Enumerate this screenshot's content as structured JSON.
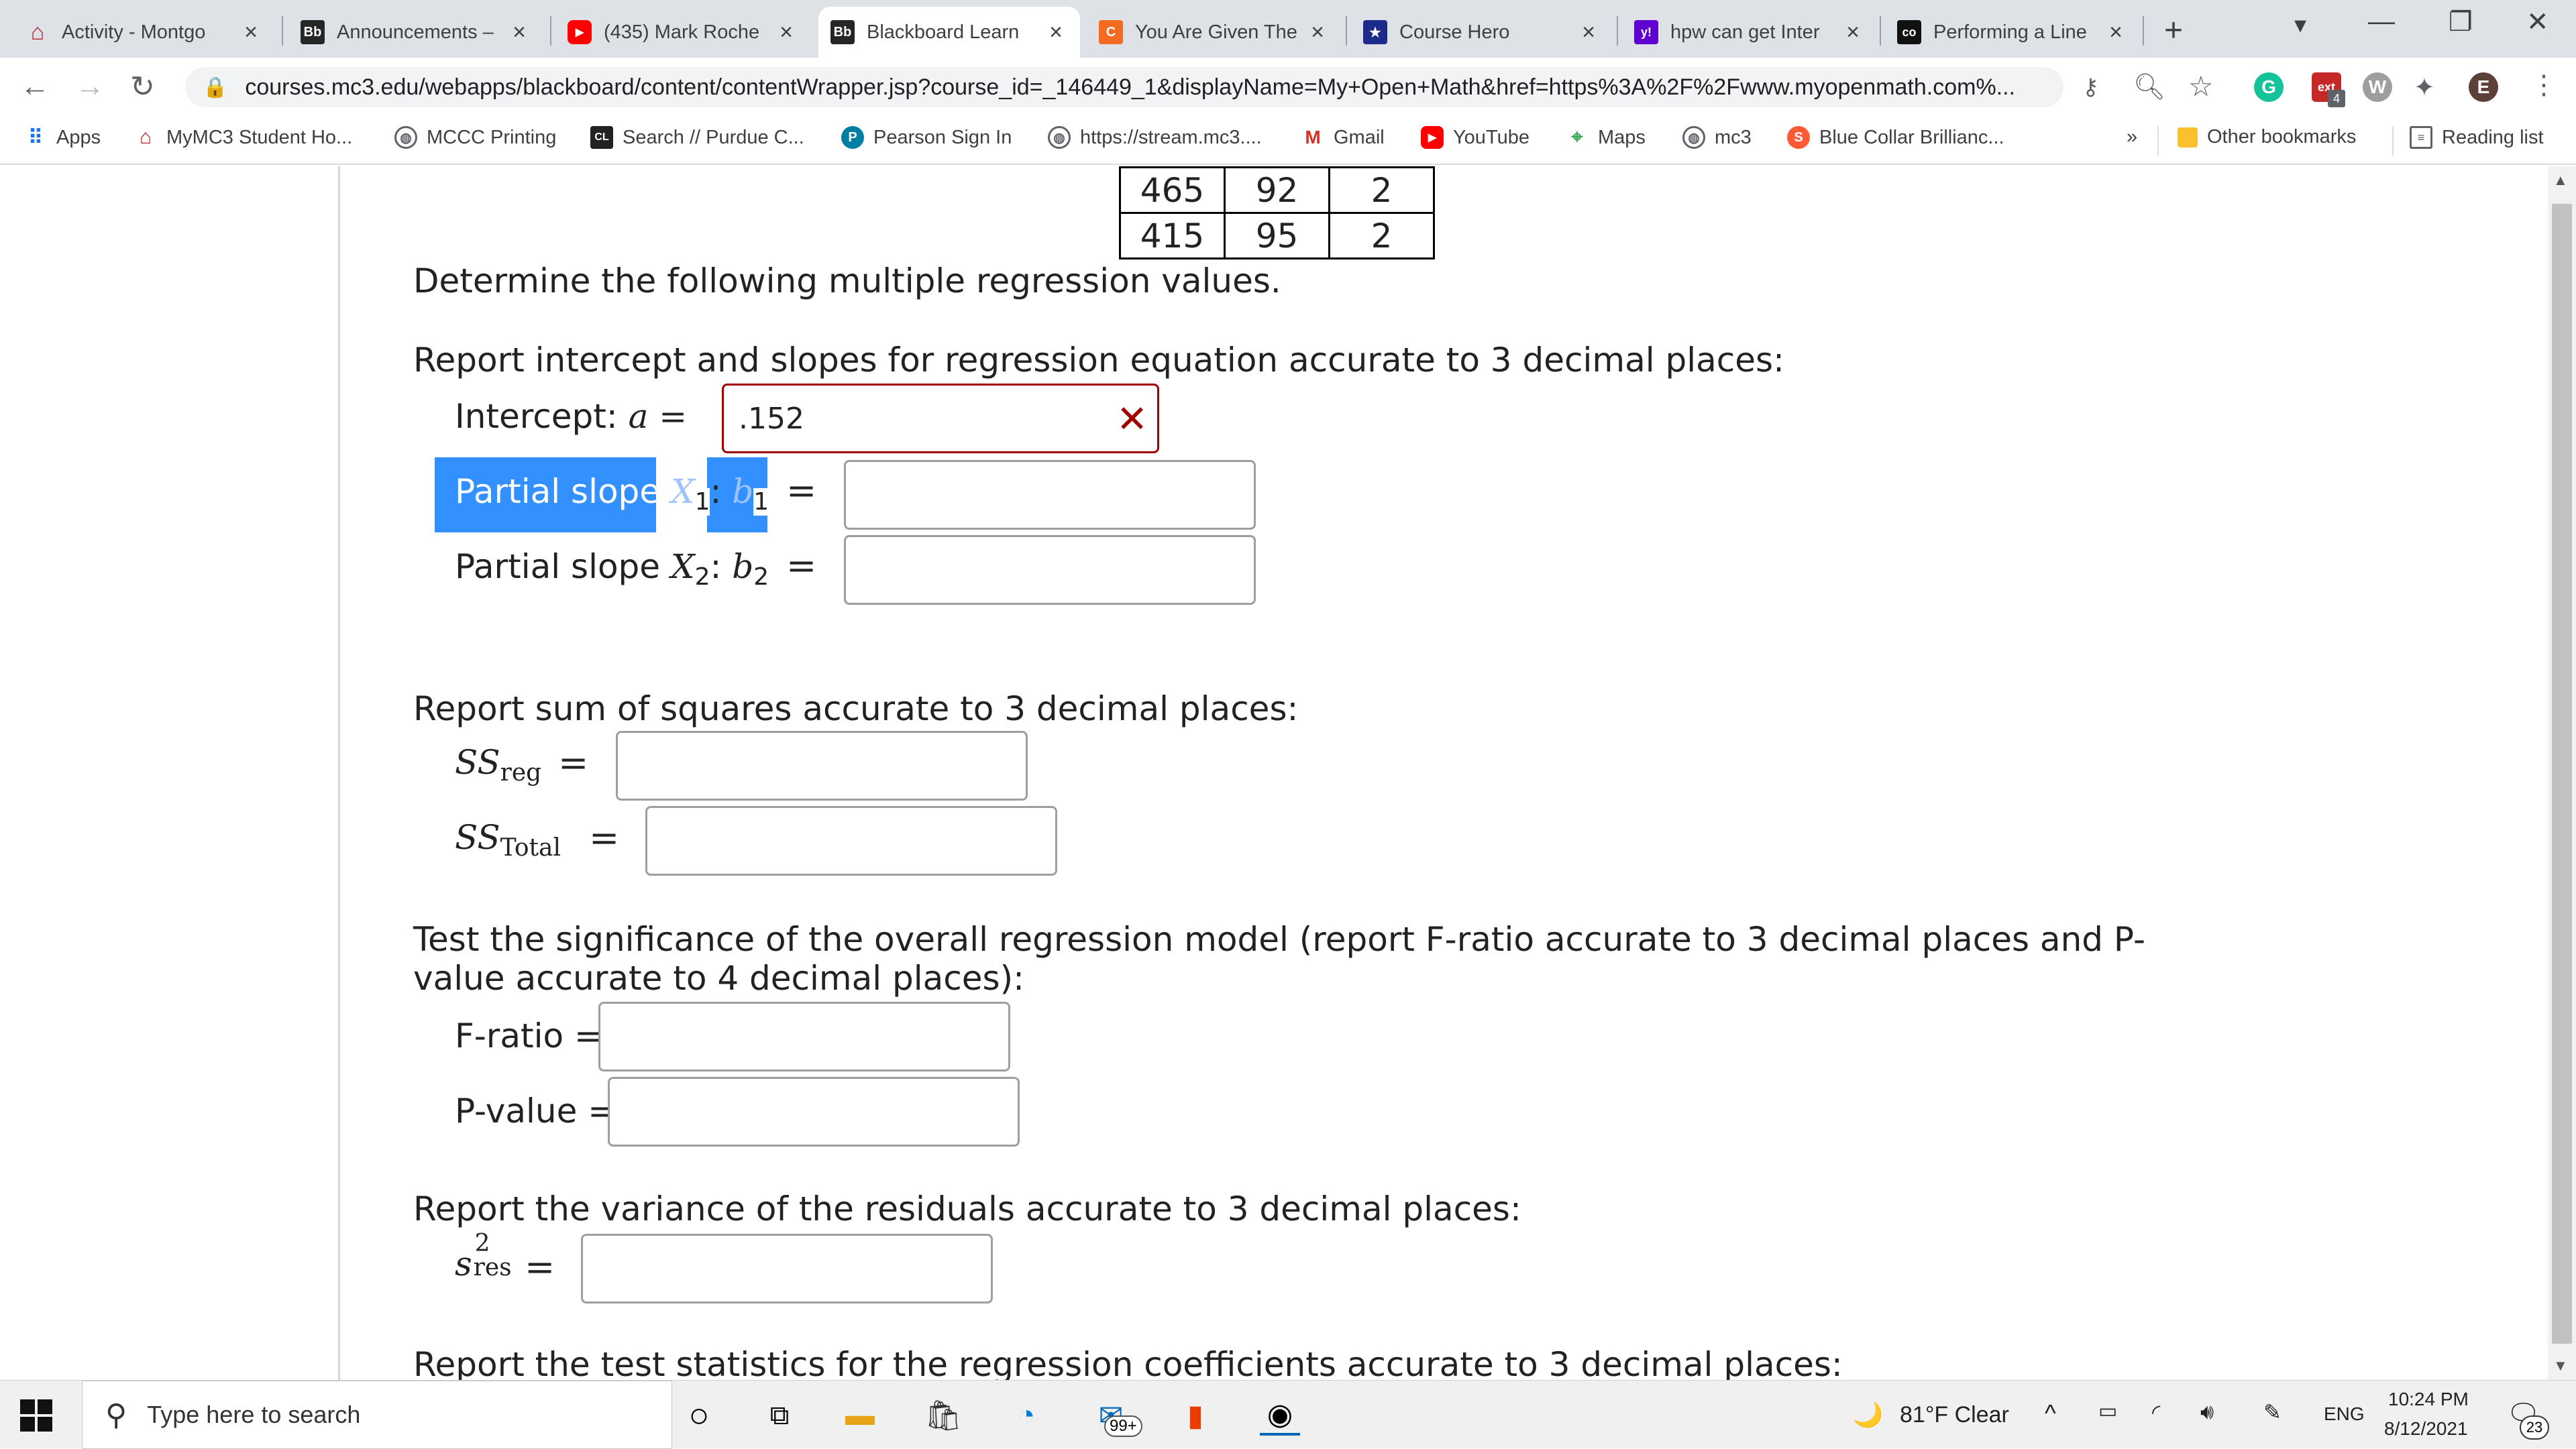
{
  "tabs": [
    {
      "title": "Activity - Montgo",
      "favicon": "mymc3-icon",
      "fav_text": "⌂"
    },
    {
      "title": "Announcements –",
      "favicon": "blackboard-icon",
      "fav_text": "Bb"
    },
    {
      "title": "(435) Mark Roche",
      "favicon": "youtube-icon",
      "fav_text": "▶"
    },
    {
      "title": "Blackboard Learn",
      "favicon": "blackboard-icon",
      "fav_text": "Bb"
    },
    {
      "title": "You Are Given The",
      "favicon": "chegg-icon",
      "fav_text": "C"
    },
    {
      "title": "Course Hero",
      "favicon": "coursehero-icon",
      "fav_text": "★"
    },
    {
      "title": "hpw can get Inter",
      "favicon": "yahoo-icon",
      "fav_text": "y!"
    },
    {
      "title": "Performing a Line",
      "favicon": "studocu-icon",
      "fav_text": "co"
    }
  ],
  "url": "courses.mc3.edu/webapps/blackboard/content/contentWrapper.jsp?course_id=_146449_1&displayName=My+Open+Math&href=https%3A%2F%2Fwww.myopenmath.com%...",
  "profile_initial": "E",
  "extension_badge": "4",
  "bookmarks": [
    {
      "label": "Apps"
    },
    {
      "label": "MyMC3 Student Ho..."
    },
    {
      "label": "MCCC Printing"
    },
    {
      "label": "Search // Purdue C..."
    },
    {
      "label": "Pearson Sign In"
    },
    {
      "label": "https://stream.mc3...."
    },
    {
      "label": "Gmail"
    },
    {
      "label": "YouTube"
    },
    {
      "label": "Maps"
    },
    {
      "label": "mc3"
    },
    {
      "label": "Blue Collar Brillianc..."
    }
  ],
  "bookmarks_overflow": "»",
  "other_bookmarks": "Other bookmarks",
  "reading_list": "Reading list",
  "table_rows": [
    [
      "465",
      "92",
      "2"
    ],
    [
      "415",
      "95",
      "2"
    ]
  ],
  "question": {
    "intro": "Determine the following multiple regression values.",
    "intercept_heading": "Report intercept and slopes for regression equation accurate to 3 decimal places:",
    "intercept_label": "Intercept: ",
    "intercept_var": "a",
    "intercept_value": ".152",
    "slope1_label": "Partial slope ",
    "slope1_var": "X",
    "slope1_sub": "1",
    "slope1_b": "b",
    "slope1_bsub": "1",
    "slope2_label": "Partial slope ",
    "slope2_var": "X",
    "slope2_sub": "2",
    "slope2_b": "b",
    "slope2_bsub": "2",
    "ss_heading": "Report sum of squares accurate to 3 decimal places:",
    "ssreg_var": "SS",
    "ssreg_sub": "reg",
    "sstotal_var": "SS",
    "sstotal_sub": "Total",
    "sig_heading_line1": "Test the significance of the overall regression model (report F-ratio accurate to 3 decimal places and P-",
    "sig_heading_line2": "value accurate to 4 decimal places):",
    "fratio_label": "F-ratio =",
    "pvalue_label": "P-value =",
    "var_heading": "Report the variance of the residuals accurate to 3 decimal places:",
    "sres_var": "s",
    "sres_sup": "2",
    "sres_sub": "res",
    "test_heading": "Report the test statistics for the regression coefficients accurate to 3 decimal places:"
  },
  "taskbar": {
    "search_placeholder": "Type here to search",
    "mail_badge": "99+",
    "weather": "81°F  Clear",
    "lang": "ENG",
    "time": "10:24 PM",
    "date": "8/12/2021",
    "notif_count": "23"
  },
  "colors": {
    "selection": "#3390ff",
    "error": "#a00000"
  }
}
